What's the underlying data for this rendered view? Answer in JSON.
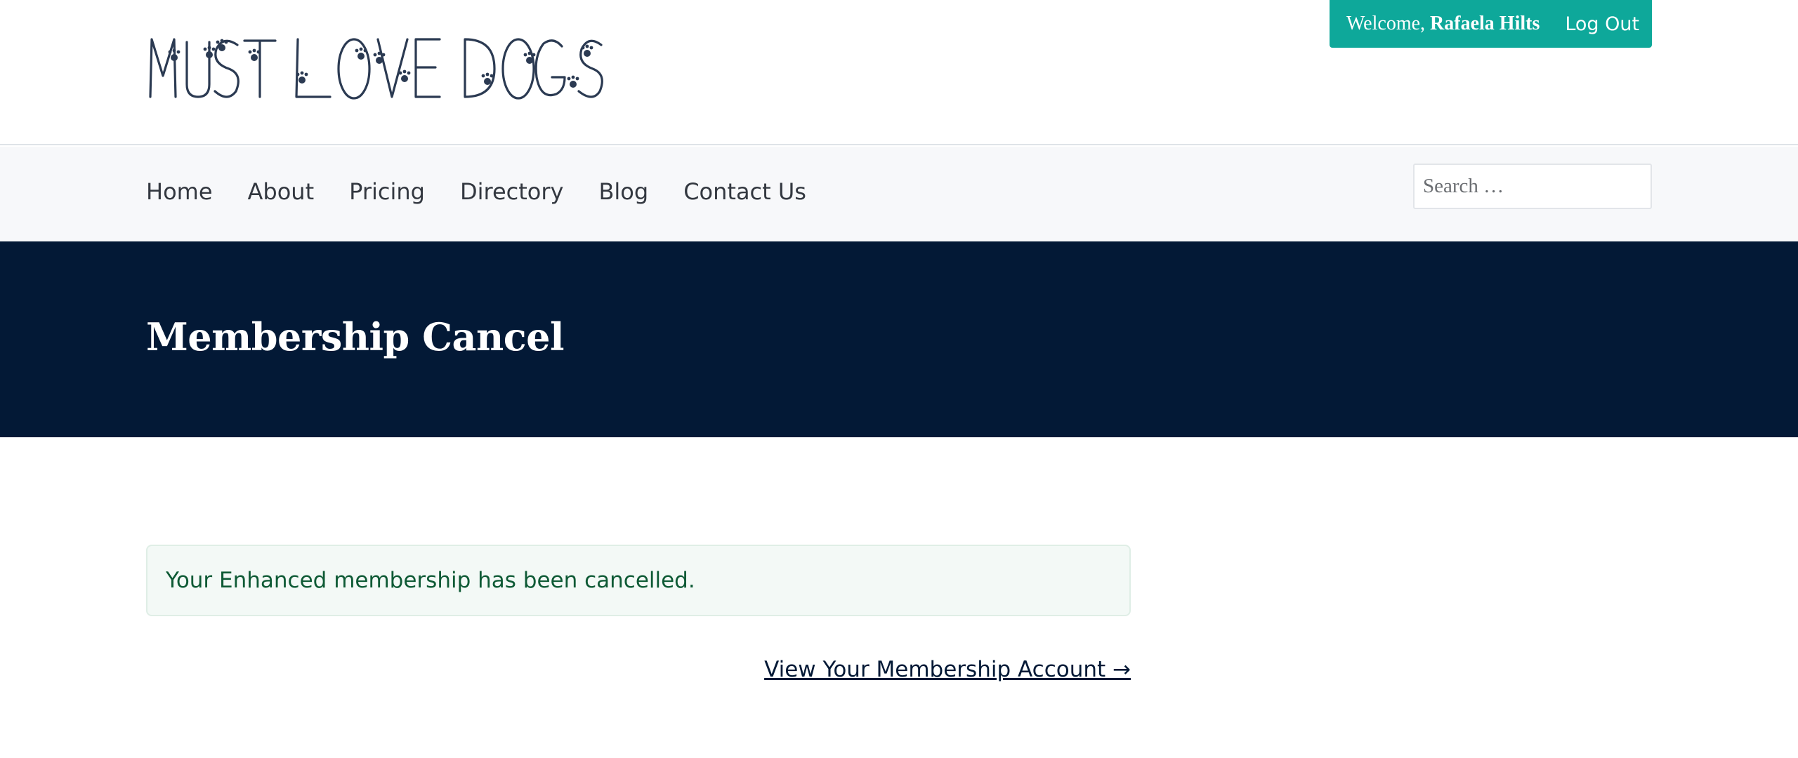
{
  "header": {
    "logo_text": "MUST LOVE DOGS",
    "welcome_prefix": "Welcome, ",
    "user_name": "Rafaela Hilts",
    "logout_label": "Log Out"
  },
  "nav": {
    "items": [
      {
        "label": "Home"
      },
      {
        "label": "About"
      },
      {
        "label": "Pricing"
      },
      {
        "label": "Directory"
      },
      {
        "label": "Blog"
      },
      {
        "label": "Contact Us"
      }
    ],
    "search_placeholder": "Search …"
  },
  "hero": {
    "title": "Membership Cancel"
  },
  "content": {
    "notice_text": "Your Enhanced membership has been cancelled.",
    "account_link_label": "View Your Membership Account →"
  },
  "colors": {
    "accent": "#0ea89a",
    "hero_bg": "#031936",
    "notice_text": "#0e5a35",
    "logo_ink": "#2b3a52"
  }
}
